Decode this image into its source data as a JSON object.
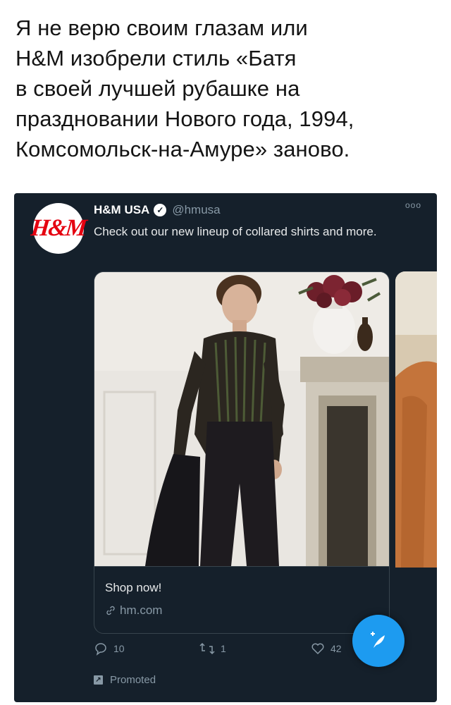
{
  "caption": {
    "lines": [
      "Я не верю своим глазам или",
      "H&M изобрели стиль «Батя",
      "в своей лучшей рубашке на",
      "праздновании Нового года, 1994,",
      "Комсомольск-на-Амуре» заново."
    ]
  },
  "tweet": {
    "avatar_text": "H&M",
    "account_name": "H&M USA",
    "handle": "@hmusa",
    "more_icon": "ooo",
    "text": "Check out our new lineup of collared shirts and more.",
    "card": {
      "cta": "Shop now!",
      "domain": "hm.com",
      "link_icon": "link-icon"
    },
    "actions": {
      "reply_count": "10",
      "retweet_count": "1",
      "like_count": "42"
    },
    "promoted_label": "Promoted",
    "compose_icon": "+"
  },
  "colors": {
    "tweet_bg": "#15202b",
    "accent": "#1d9bf0",
    "muted_text": "#8899a6",
    "brand_red": "#e50010"
  }
}
